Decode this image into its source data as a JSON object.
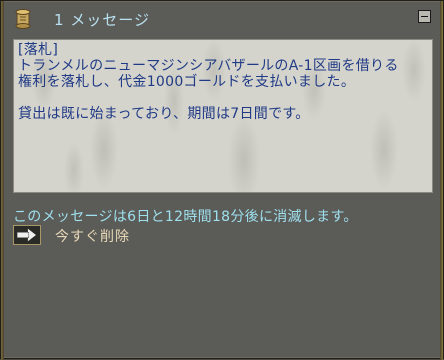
{
  "window": {
    "title": "1 メッセージ",
    "icons": {
      "title_icon": "scroll-icon",
      "minimize": "minimize-icon",
      "delete": "arrow-right-icon"
    }
  },
  "message": {
    "lines": [
      "[落札]",
      "トランメルのニューマジンシアバザールのA-1区画を借りる",
      "権利を落札し、代金1000ゴールドを支払いました。",
      "",
      "貸出は既に始まっており、期間は7日間です。"
    ]
  },
  "expiry_notice": "このメッセージは6日と12時間18分後に消滅します。",
  "actions": {
    "delete_now": "今すぐ削除"
  },
  "colors": {
    "title_text": "#b8e0f0",
    "message_text": "#203a86",
    "expiry_text": "#9ee0ee",
    "action_text": "#e8d8b8",
    "panel_background": "#d4d4cc",
    "window_background": "#5b5b57"
  }
}
